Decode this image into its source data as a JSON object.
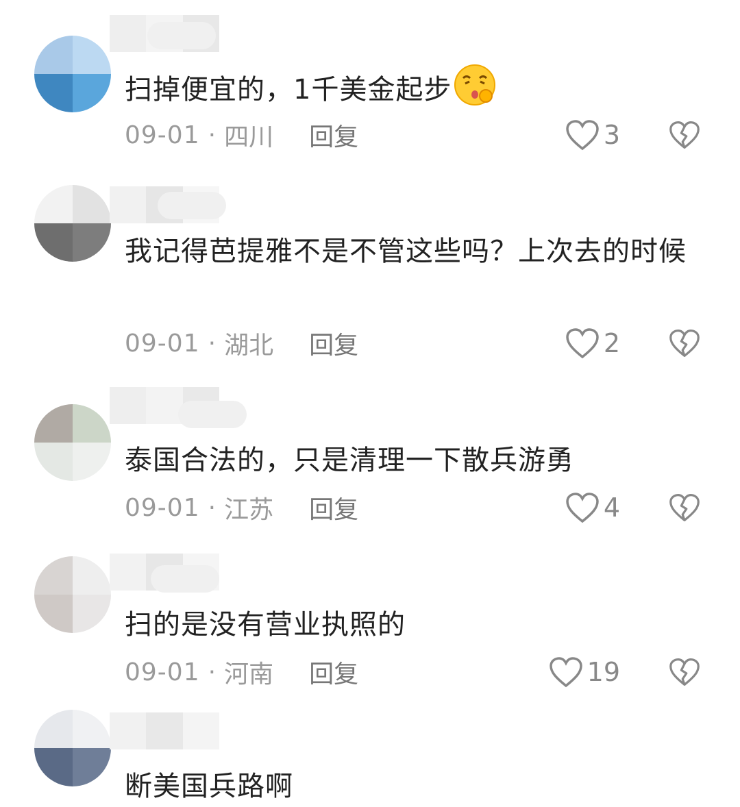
{
  "comments": [
    {
      "text": "扫掉便宜的，1千美金起步",
      "emoji": "face-blowing-kiss-emoji",
      "date": "09-01",
      "location": "四川",
      "reply_label": "回复",
      "likes": "3"
    },
    {
      "text": "我记得芭提雅不是不管这些吗？上次去的时候",
      "date": "09-01",
      "location": "湖北",
      "reply_label": "回复",
      "likes": "2"
    },
    {
      "text": "泰国合法的，只是清理一下散兵游勇",
      "date": "09-01",
      "location": "江苏",
      "reply_label": "回复",
      "likes": "4"
    },
    {
      "text": "扫的是没有营业执照的",
      "date": "09-01",
      "location": "河南",
      "reply_label": "回复",
      "likes": "19"
    },
    {
      "text": "断美国兵路啊"
    }
  ],
  "separator": "·",
  "icons": {
    "like": "heart-outline-icon",
    "dislike": "broken-heart-icon"
  },
  "colors": {
    "text": "#222222",
    "meta": "#9a9a9a",
    "icon": "#888888"
  }
}
